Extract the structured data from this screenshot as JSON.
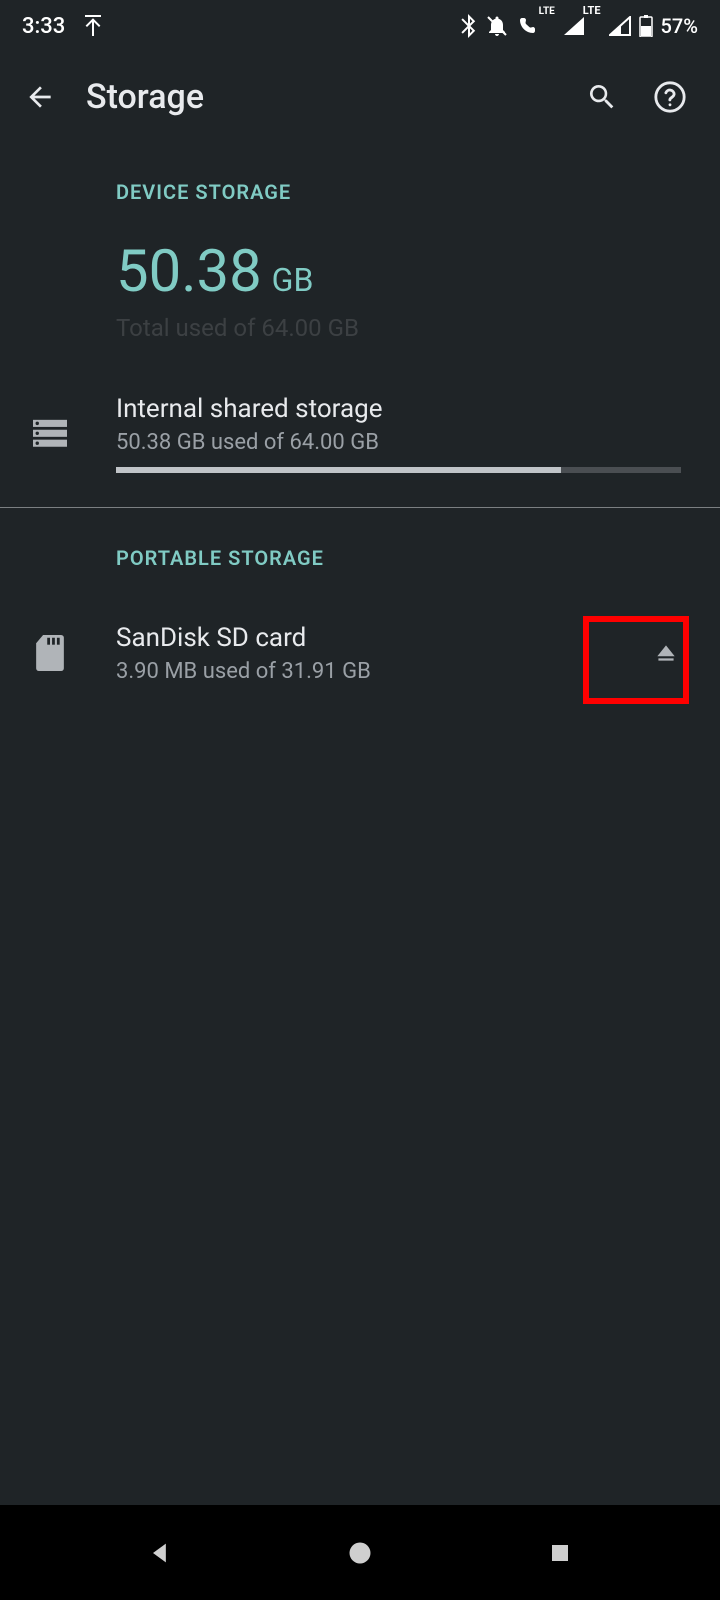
{
  "status": {
    "time": "3:33",
    "battery_pct": "57%"
  },
  "appbar": {
    "title": "Storage"
  },
  "device_section": {
    "label": "DEVICE STORAGE",
    "big_value": "50.38",
    "big_unit": "GB",
    "subtext": "Total used of 64.00 GB"
  },
  "internal": {
    "title": "Internal shared storage",
    "sub": "50.38 GB used of 64.00 GB",
    "fill_pct": 78.7
  },
  "portable_section": {
    "label": "PORTABLE STORAGE"
  },
  "sdcard": {
    "title": "SanDisk SD card",
    "sub": "3.90 MB used of 31.91 GB"
  }
}
